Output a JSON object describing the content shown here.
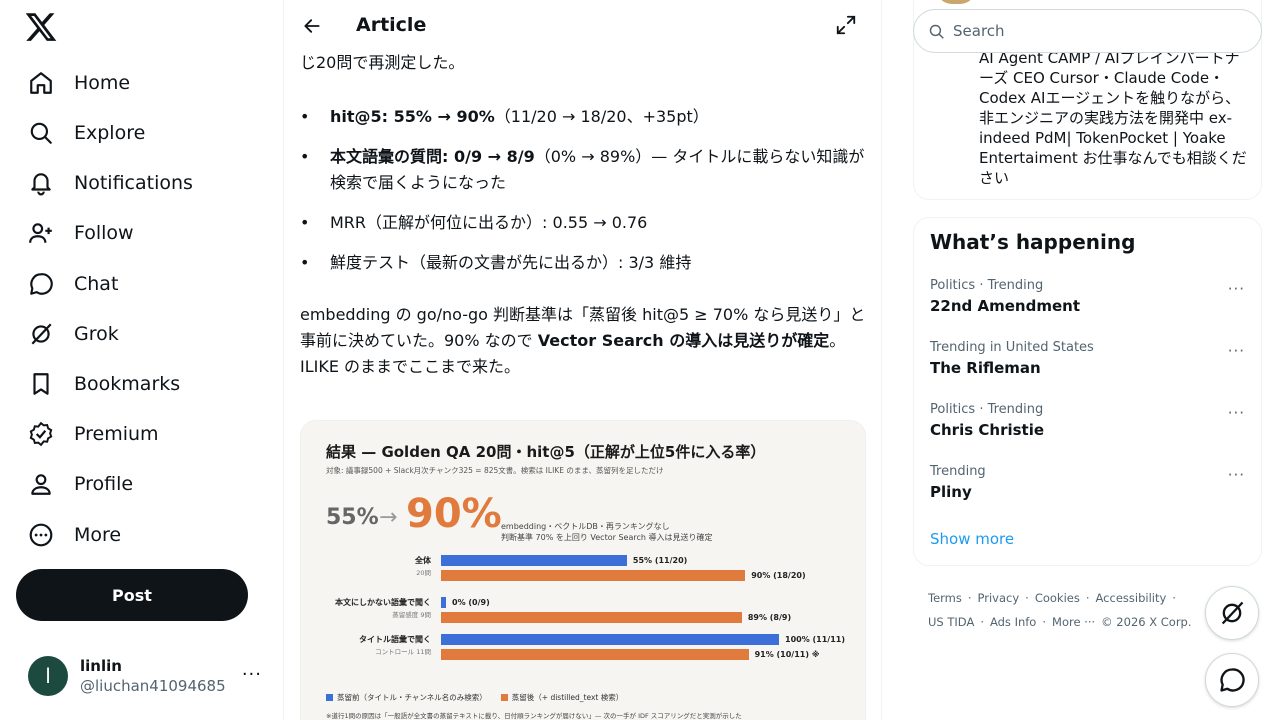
{
  "nav": {
    "items": [
      {
        "label": "Home"
      },
      {
        "label": "Explore"
      },
      {
        "label": "Notifications"
      },
      {
        "label": "Follow"
      },
      {
        "label": "Chat"
      },
      {
        "label": "Grok"
      },
      {
        "label": "Bookmarks"
      },
      {
        "label": "Premium"
      },
      {
        "label": "Profile"
      },
      {
        "label": "More"
      }
    ],
    "post_label": "Post"
  },
  "account": {
    "initial": "l",
    "name": "linlin",
    "handle": "@liuchan41094685",
    "more": "···"
  },
  "article": {
    "header_title": "Article",
    "intro_tail": "じ20問で再測定した。",
    "bullets": [
      {
        "bold": "hit@5: 55% → 90%",
        "rest": "（11/20 → 18/20、+35pt）"
      },
      {
        "bold": "本文語彙の質問: 0/9 → 8/9",
        "rest": "（0% → 89%）— タイトルに載らない知識が検索で届くようになった"
      },
      {
        "bold": "",
        "rest": "MRR（正解が何位に出るか）: 0.55 → 0.76"
      },
      {
        "bold": "",
        "rest": "鮮度テスト（最新の文書が先に出るか）: 3/3 維持"
      }
    ],
    "para_a": "embedding の go/no-go 判断基準は「蒸留後 hit@5 ≥ 70% なら見送り」と事前に決めていた。90% なので ",
    "para_bold": "Vector Search の導入は見送りが確定",
    "para_b": "。ILIKE のままでここまで来た。"
  },
  "figure": {
    "title": "結果 — Golden QA 20問・hit@5（正解が上位5件に入る率）",
    "subtitle": "対象: 議事録500 + Slack月次チャンク325 = 825文書。検索は ILIKE のまま、蒸留列を足しただけ",
    "big_from": "55%",
    "big_arrow": "→",
    "big_to": "90%",
    "note1": "embedding・ベクトルDB・再ランキングなし",
    "note2": "判断基準 70% を上回り Vector Search 導入は見送り確定",
    "groups": [
      {
        "label": "全体",
        "sub": "20問",
        "before": 55,
        "before_text": "55% (11/20)",
        "after": 90,
        "after_text": "90% (18/20)"
      },
      {
        "label": "本文にしかない語彙で聞く",
        "sub": "蒸留感度 9問",
        "before": 0,
        "before_text": "0% (0/9)",
        "after": 89,
        "after_text": "89% (8/9)"
      },
      {
        "label": "タイトル語彙で聞く",
        "sub": "コントロール 11問",
        "before": 100,
        "before_text": "100% (11/11)",
        "after": 91,
        "after_text": "91% (10/11) ※"
      }
    ],
    "legend_before": "蒸留前（タイトル・チャンネル名のみ検索）",
    "legend_after": "蒸留後（+ distilled_text 検索）",
    "footnote": "※道行1問の原因は「一般語が全文書の蒸留テキストに載り、日付順ランキングが届けない」— 次の一手が IDF スコアリングだと実測が示した",
    "colors": {
      "before": "#3d6fd8",
      "after": "#e07a3d"
    }
  },
  "right": {
    "search_placeholder": "Search",
    "bio": "AI Agent CAMP / AIプレインパートナーズ CEO Cursor・Claude Code・ Codex AIエージェントを触りながら、非エンジニアの実践方法を開発中 ex-indeed PdM| TokenPocket | Yoake Entertaiment お仕事なんでも相談ください",
    "trends_title": "What’s happening",
    "trends": [
      {
        "context": "Politics · Trending",
        "name": "22nd Amendment"
      },
      {
        "context": "Trending in United States",
        "name": "The Rifleman"
      },
      {
        "context": "Politics · Trending",
        "name": "Chris Christie"
      },
      {
        "context": "Trending",
        "name": "Pliny"
      }
    ],
    "show_more": "Show more",
    "footer_links": [
      "Terms",
      "·",
      "Privacy",
      "·",
      "Cookies",
      "·",
      "Accessibility",
      "·",
      "US TIDA",
      "·",
      "Ads Info",
      "·",
      "More ···",
      "© 2026 X Corp."
    ]
  }
}
